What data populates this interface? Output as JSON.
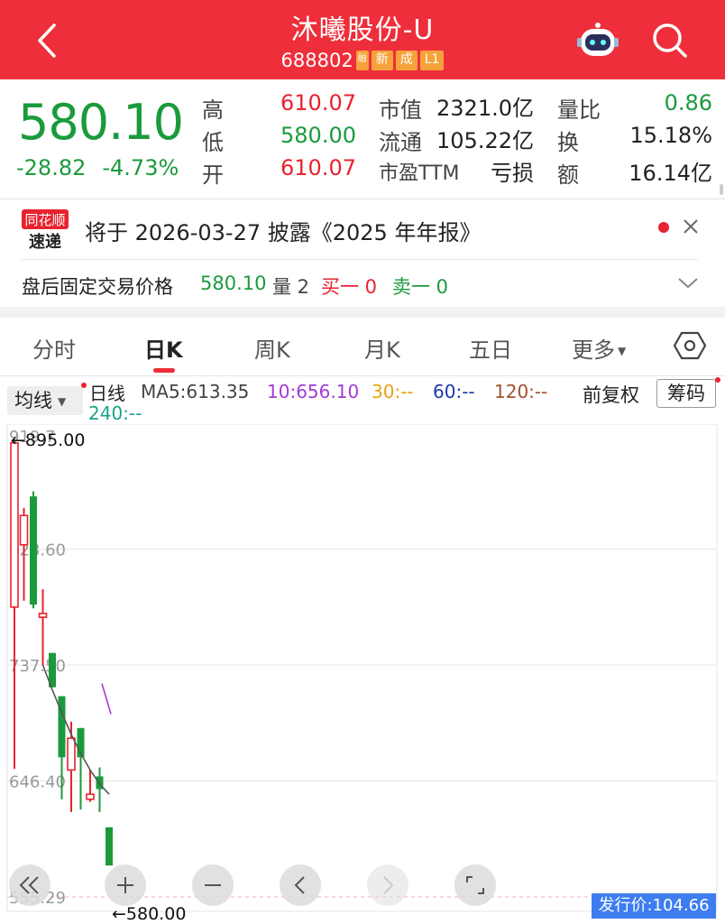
{
  "header": {
    "title": "沐曦股份-U",
    "code": "688802",
    "tags": [
      "融",
      "新",
      "成",
      "L1"
    ]
  },
  "quote": {
    "price": "580.10",
    "change": "-28.82",
    "change_pct": "-4.73%",
    "stats": [
      {
        "label": "高",
        "value": "610.07"
      },
      {
        "label": "低",
        "value": "580.00"
      },
      {
        "label": "开",
        "value": "610.07"
      },
      {
        "label": "市值",
        "value": "2321.0亿"
      },
      {
        "label": "流通",
        "value": "105.22亿"
      },
      {
        "label": "市盈TTM",
        "value": "亏损"
      },
      {
        "label": "量比",
        "value": "0.86"
      },
      {
        "label": "换",
        "value": "15.18%"
      },
      {
        "label": "额",
        "value": "16.14亿"
      }
    ]
  },
  "news": {
    "logo_top": "同花顺",
    "logo_bottom": "速递",
    "text": "将于 2026-03-27 披露《2025 年年报》"
  },
  "after_hours": {
    "label": "盘后固定交易价格",
    "price": "580.10",
    "volume": "量 2",
    "buy1": "买一 0",
    "sell1": "卖一 0"
  },
  "tabs": [
    "分时",
    "日K",
    "周K",
    "月K",
    "五日",
    "更多"
  ],
  "active_tab": "日K",
  "chart_header": {
    "avg_label": "均线",
    "line_type": "日线",
    "ma5": "MA5:613.35",
    "ma10": "10:656.10",
    "ma30": "30:--",
    "ma60": "60:--",
    "ma120": "120:--",
    "ma240": "240:--",
    "adjust": "前复权",
    "chips": "筹码"
  },
  "colors": {
    "up": "#e8232f",
    "down": "#1b9a3c",
    "ma5": "#555555",
    "ma10": "#a23bd6",
    "ma30": "#e8a317",
    "ma60": "#1f3aa8",
    "ma120": "#a0522d",
    "ma240": "#1aa38a",
    "header": "#ee2e3a"
  },
  "chart_data": {
    "type": "candlestick",
    "y_ticks": [
      "828.60",
      "737.50",
      "646.40",
      "555.29"
    ],
    "top_label": "919.7",
    "max_marker": "←895.00",
    "min_marker": "←580.00",
    "issue_price_label": "发行价:104.66",
    "ylim": [
      555.29,
      919.7
    ],
    "candles": [
      {
        "open": 783,
        "close": 912,
        "high": 895,
        "low": 656,
        "dir": "up"
      },
      {
        "open": 855,
        "close": 832,
        "high": 861,
        "low": 788,
        "dir": "up"
      },
      {
        "open": 785,
        "close": 870,
        "high": 874,
        "low": 782,
        "dir": "down"
      },
      {
        "open": 775,
        "close": 778,
        "high": 797,
        "low": 737,
        "dir": "up"
      },
      {
        "open": 747,
        "close": 720,
        "high": 747,
        "low": 720,
        "dir": "down"
      },
      {
        "open": 665,
        "close": 713,
        "high": 706,
        "low": 632,
        "dir": "down"
      },
      {
        "open": 655,
        "close": 680,
        "high": 693,
        "low": 622,
        "dir": "up"
      },
      {
        "open": 665,
        "close": 688,
        "high": 684,
        "low": 624,
        "dir": "down"
      },
      {
        "open": 632,
        "close": 636,
        "high": 655,
        "low": 630,
        "dir": "up"
      },
      {
        "open": 650,
        "close": 640,
        "high": 657,
        "low": 622,
        "dir": "down"
      },
      {
        "open": 580,
        "close": 610,
        "high": 610,
        "low": 580,
        "dir": "down"
      }
    ],
    "ma5": [
      737.5,
      718,
      700,
      683,
      668,
      655,
      644,
      636
    ],
    "ma10": [
      723,
      699
    ]
  },
  "toolbar": [
    "«",
    "+",
    "−",
    "‹",
    "›",
    "⌟"
  ]
}
